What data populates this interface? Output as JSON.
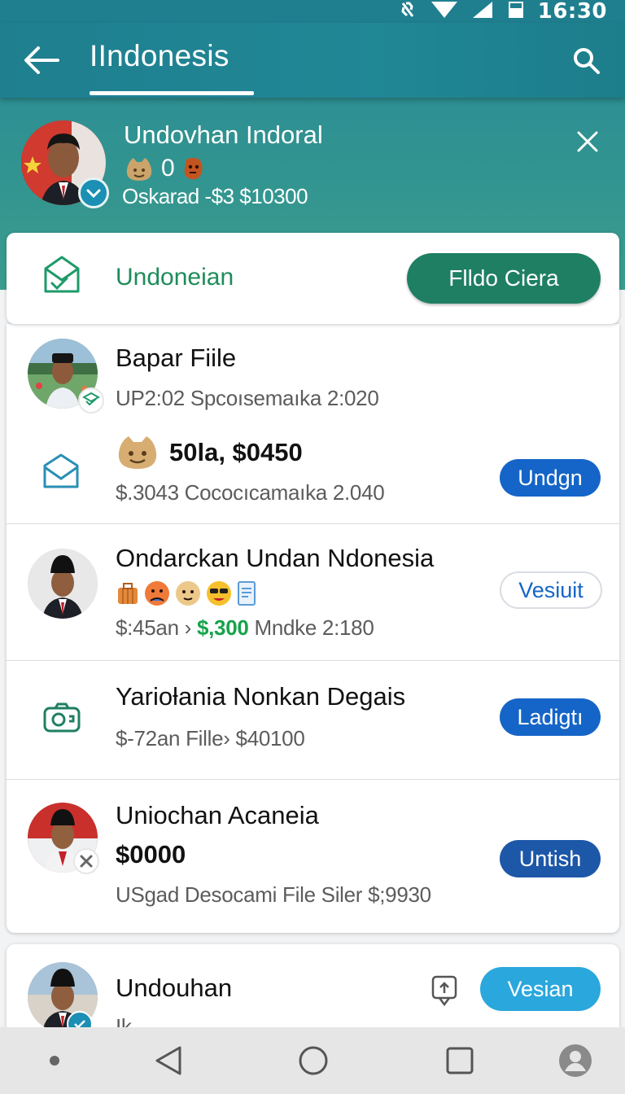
{
  "status_bar": {
    "time": "16:30"
  },
  "app_bar": {
    "title": "IIndonesis"
  },
  "profile": {
    "name": "Undovhan Indoral",
    "count": "0",
    "subtitle": "Oskarad -$3 $10300"
  },
  "action_card": {
    "label": "Undoneian",
    "button_label": "Flldo Ciera"
  },
  "items": [
    {
      "title": "Bapar Fiile",
      "subtitle": "UP2:02 Spcoısemaıka 2:020",
      "amount": "50la, $0450",
      "detail": "$.3043 Cococıcamaıka 2.040",
      "button_label": "Undgn"
    },
    {
      "title": "Ondarckan Undan Ndonesia",
      "detail_prefix": "$:45an ›",
      "detail_highlight": "$,300",
      "detail_suffix": "Mndke 2:180",
      "button_label": "Vesiuit"
    },
    {
      "title": "Yarioƚania Nonkan Degais",
      "detail": "$-72an Fille› $40100",
      "button_label": "Ladigtı"
    },
    {
      "title": "Uniochan Acaneia",
      "amount": "$0000",
      "detail": "USgad Desocami File Siler $;9930",
      "button_label": "Untish"
    },
    {
      "title": "Undouhan",
      "detail": "Ik",
      "button_label": "Vesian"
    }
  ],
  "colors": {
    "primary": "#1f7f8f",
    "header": "#2d8f92",
    "accent_green": "#1f7f63",
    "button_blue": "#1565c8",
    "button_cyan": "#2aa7dc"
  }
}
